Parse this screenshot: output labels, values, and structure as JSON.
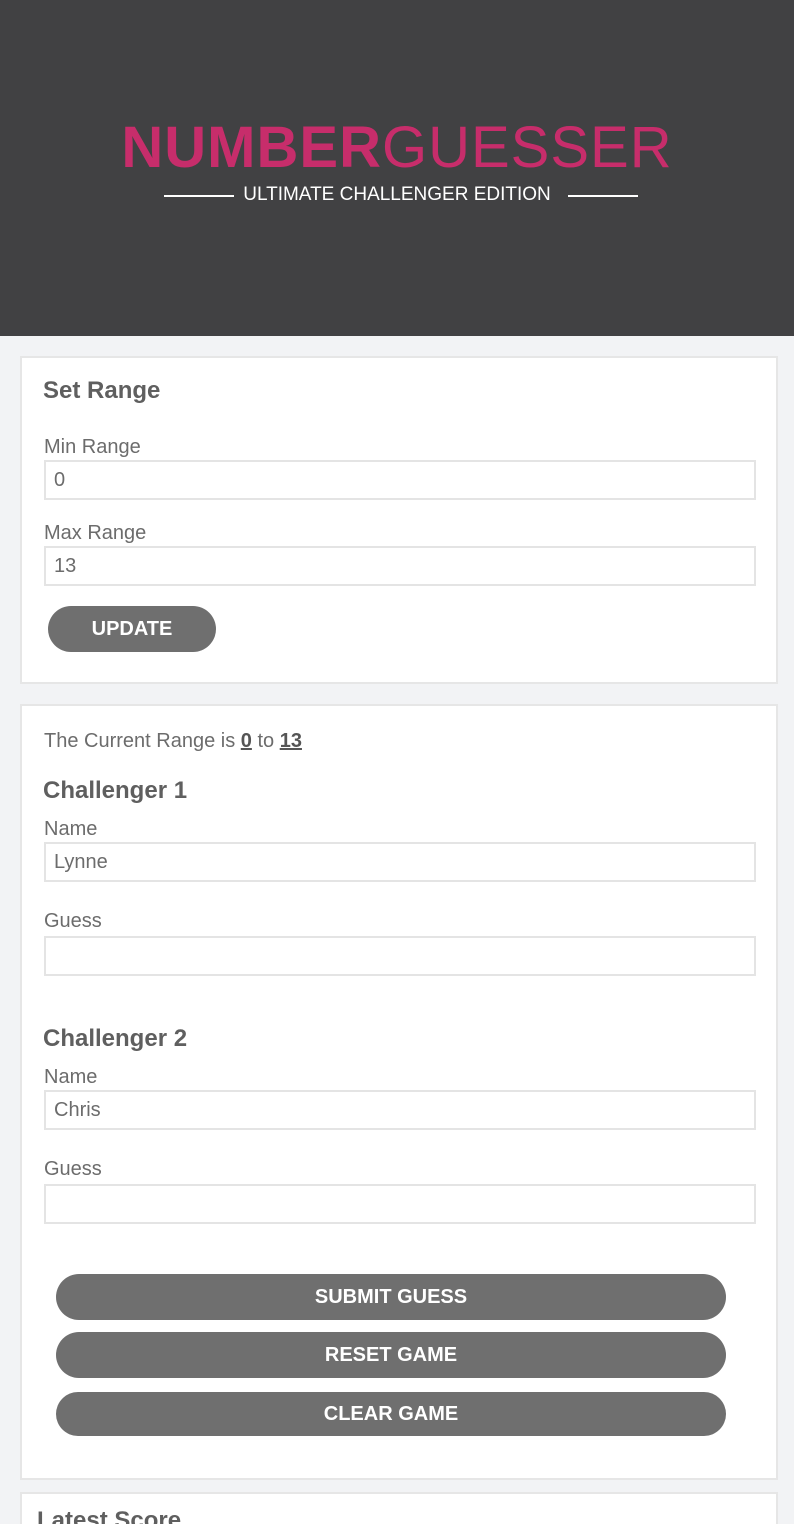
{
  "header": {
    "logo_bold": "NUMBER",
    "logo_light": "GUESSER",
    "tagline": "ULTIMATE CHALLENGER EDITION"
  },
  "set_range": {
    "title": "Set Range",
    "min_label": "Min Range",
    "min_value": "0",
    "max_label": "Max Range",
    "max_value": "13",
    "update_button": "UPDATE"
  },
  "game": {
    "range_prefix": "The Current Range is",
    "range_min": "0",
    "range_joiner": "to",
    "range_max": "13",
    "challenger1": {
      "title": "Challenger 1",
      "name_label": "Name",
      "name_value": "Lynne",
      "guess_label": "Guess",
      "guess_value": ""
    },
    "challenger2": {
      "title": "Challenger 2",
      "name_label": "Name",
      "name_value": "Chris",
      "guess_label": "Guess",
      "guess_value": ""
    },
    "submit_button": "SUBMIT GUESS",
    "reset_button": "RESET GAME",
    "clear_button": "CLEAR GAME"
  },
  "score": {
    "title": "Latest Score"
  },
  "colors": {
    "header_bg": "#414143",
    "brand_pink": "#c72d6b",
    "button_gray": "#6f6f6f",
    "page_bg": "#f2f3f5"
  }
}
